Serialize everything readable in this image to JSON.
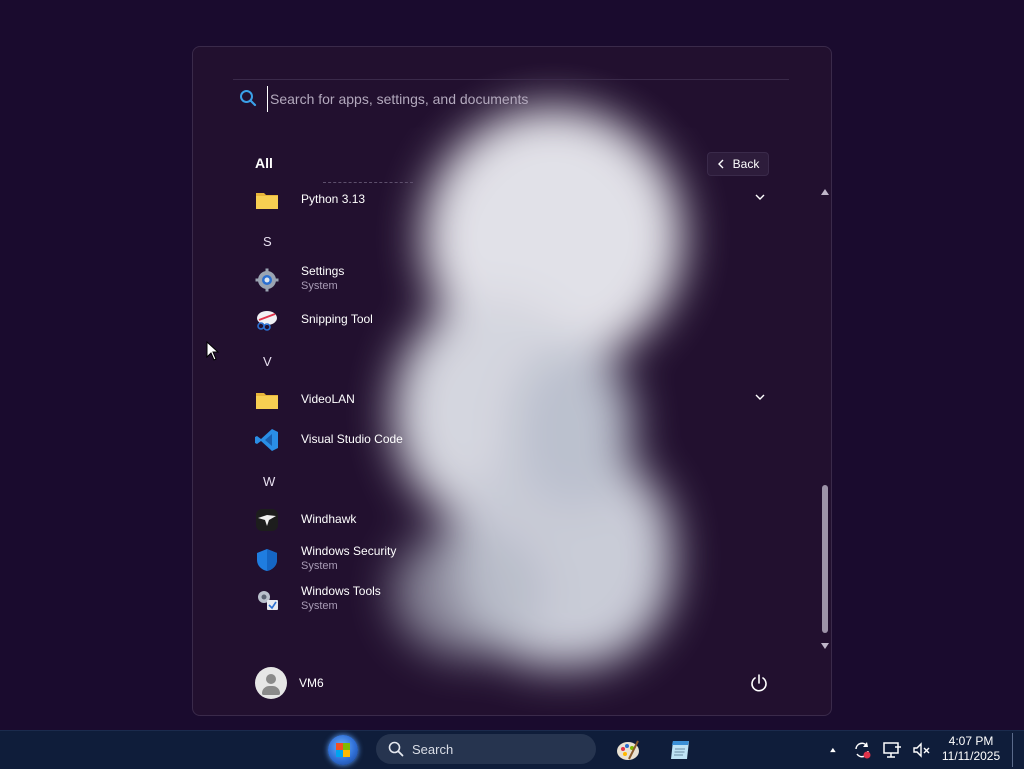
{
  "search": {
    "placeholder": "Search for apps, settings, and documents"
  },
  "start_menu": {
    "section_title": "All",
    "back_label": "Back",
    "letters": {
      "s": "S",
      "v": "V",
      "w": "W"
    },
    "items": [
      {
        "name": "Python 3.13",
        "sub": "",
        "icon": "folder-icon",
        "has_chevron": true
      },
      {
        "name": "Settings",
        "sub": "System",
        "icon": "gear-icon"
      },
      {
        "name": "Snipping Tool",
        "sub": "",
        "icon": "snipping-tool-icon"
      },
      {
        "name": "VideoLAN",
        "sub": "",
        "icon": "folder-icon",
        "has_chevron": true
      },
      {
        "name": "Visual Studio Code",
        "sub": "",
        "icon": "vscode-icon"
      },
      {
        "name": "Windhawk",
        "sub": "",
        "icon": "windhawk-icon"
      },
      {
        "name": "Windows Security",
        "sub": "System",
        "icon": "shield-icon"
      },
      {
        "name": "Windows Tools",
        "sub": "System",
        "icon": "tools-icon"
      }
    ],
    "user": {
      "name": "VM6"
    }
  },
  "taskbar": {
    "search_label": "Search",
    "clock": {
      "time": "4:07 PM",
      "date": "11/11/2025"
    }
  },
  "colors": {
    "desktop_bg": "#1a0b2e",
    "menu_bg": "#22102f",
    "taskbar_bg": "#0f1d3a",
    "folder": "#f2c94c",
    "vscode": "#2a8ee6",
    "shield": "#1f7de0"
  }
}
